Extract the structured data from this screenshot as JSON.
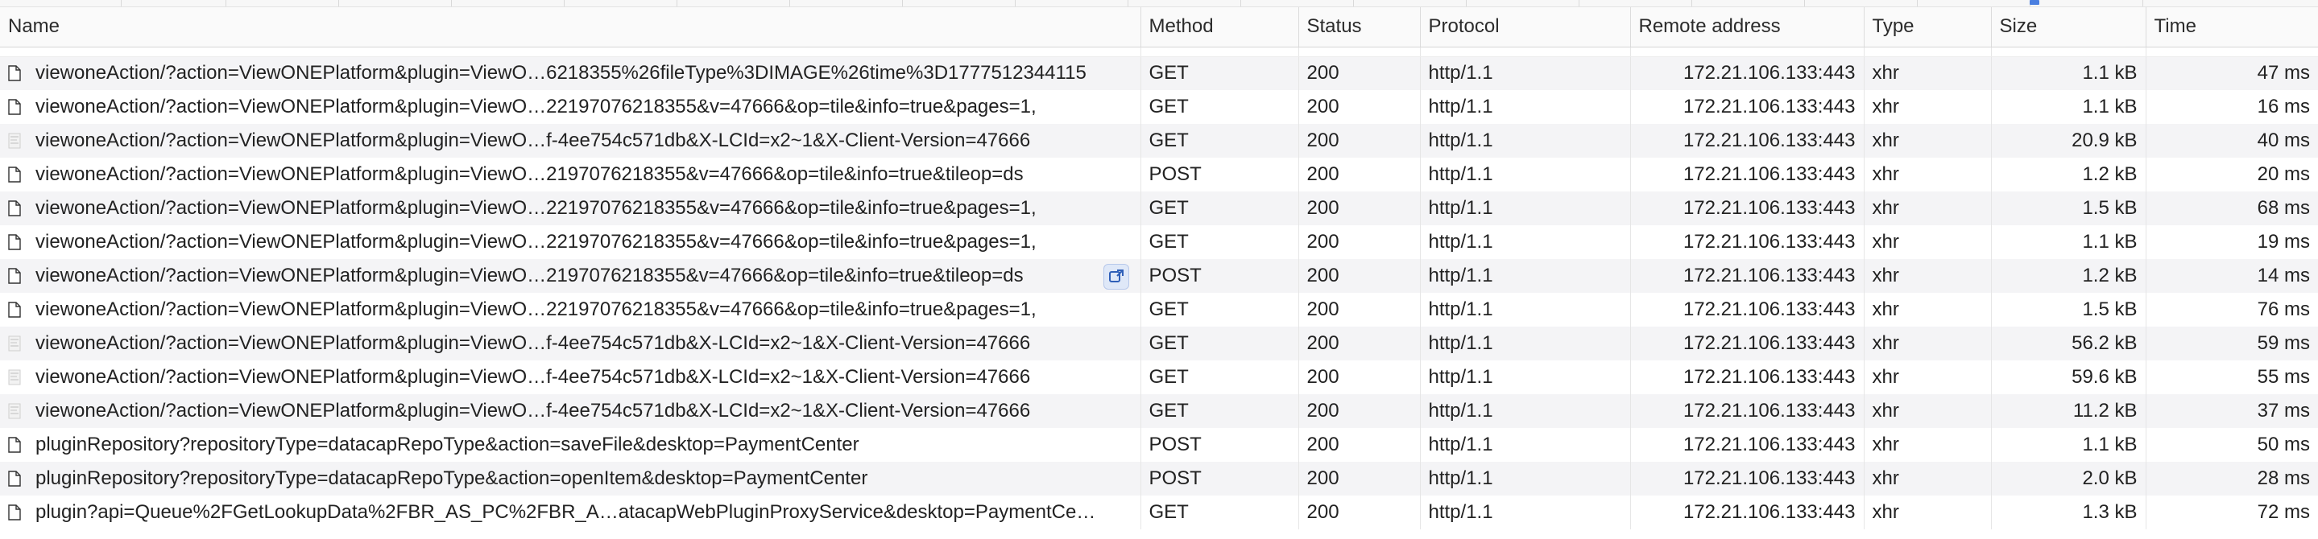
{
  "columns": {
    "name": "Name",
    "method": "Method",
    "status": "Status",
    "protocol": "Protocol",
    "remote": "Remote address",
    "type": "Type",
    "size": "Size",
    "time": "Time"
  },
  "rows": [
    {
      "name": "viewoneAction/?action=ViewONEPlatform&plugin=ViewO…6218355%26fileType%3DIMAGE%26time%3D1777512344115",
      "method": "GET",
      "status": "200",
      "protocol": "http/1.1",
      "remote": "172.21.106.133:443",
      "type": "xhr",
      "size": "1.1 kB",
      "time": "47 ms",
      "icon": "document-icon"
    },
    {
      "name": "viewoneAction/?action=ViewONEPlatform&plugin=ViewO…22197076218355&v=47666&op=tile&info=true&pages=1,",
      "method": "GET",
      "status": "200",
      "protocol": "http/1.1",
      "remote": "172.21.106.133:443",
      "type": "xhr",
      "size": "1.1 kB",
      "time": "16 ms",
      "icon": "document-icon"
    },
    {
      "name": "viewoneAction/?action=ViewONEPlatform&plugin=ViewO…f-4ee754c571db&X-LCId=x2~1&X-Client-Version=47666",
      "method": "GET",
      "status": "200",
      "protocol": "http/1.1",
      "remote": "172.21.106.133:443",
      "type": "xhr",
      "size": "20.9 kB",
      "time": "40 ms",
      "icon": "image-thumb-icon"
    },
    {
      "name": "viewoneAction/?action=ViewONEPlatform&plugin=ViewO…2197076218355&v=47666&op=tile&info=true&tileop=ds",
      "method": "POST",
      "status": "200",
      "protocol": "http/1.1",
      "remote": "172.21.106.133:443",
      "type": "xhr",
      "size": "1.2 kB",
      "time": "20 ms",
      "icon": "document-icon"
    },
    {
      "name": "viewoneAction/?action=ViewONEPlatform&plugin=ViewO…22197076218355&v=47666&op=tile&info=true&pages=1,",
      "method": "GET",
      "status": "200",
      "protocol": "http/1.1",
      "remote": "172.21.106.133:443",
      "type": "xhr",
      "size": "1.5 kB",
      "time": "68 ms",
      "icon": "document-icon"
    },
    {
      "name": "viewoneAction/?action=ViewONEPlatform&plugin=ViewO…22197076218355&v=47666&op=tile&info=true&pages=1,",
      "method": "GET",
      "status": "200",
      "protocol": "http/1.1",
      "remote": "172.21.106.133:443",
      "type": "xhr",
      "size": "1.1 kB",
      "time": "19 ms",
      "icon": "document-icon"
    },
    {
      "name": "viewoneAction/?action=ViewONEPlatform&plugin=ViewO…2197076218355&v=47666&op=tile&info=true&tileop=ds",
      "method": "POST",
      "status": "200",
      "protocol": "http/1.1",
      "remote": "172.21.106.133:443",
      "type": "xhr",
      "size": "1.2 kB",
      "time": "14 ms",
      "icon": "document-icon",
      "badge": "resend-icon"
    },
    {
      "name": "viewoneAction/?action=ViewONEPlatform&plugin=ViewO…22197076218355&v=47666&op=tile&info=true&pages=1,",
      "method": "GET",
      "status": "200",
      "protocol": "http/1.1",
      "remote": "172.21.106.133:443",
      "type": "xhr",
      "size": "1.5 kB",
      "time": "76 ms",
      "icon": "document-icon"
    },
    {
      "name": "viewoneAction/?action=ViewONEPlatform&plugin=ViewO…f-4ee754c571db&X-LCId=x2~1&X-Client-Version=47666",
      "method": "GET",
      "status": "200",
      "protocol": "http/1.1",
      "remote": "172.21.106.133:443",
      "type": "xhr",
      "size": "56.2 kB",
      "time": "59 ms",
      "icon": "image-thumb-icon"
    },
    {
      "name": "viewoneAction/?action=ViewONEPlatform&plugin=ViewO…f-4ee754c571db&X-LCId=x2~1&X-Client-Version=47666",
      "method": "GET",
      "status": "200",
      "protocol": "http/1.1",
      "remote": "172.21.106.133:443",
      "type": "xhr",
      "size": "59.6 kB",
      "time": "55 ms",
      "icon": "image-thumb-icon"
    },
    {
      "name": "viewoneAction/?action=ViewONEPlatform&plugin=ViewO…f-4ee754c571db&X-LCId=x2~1&X-Client-Version=47666",
      "method": "GET",
      "status": "200",
      "protocol": "http/1.1",
      "remote": "172.21.106.133:443",
      "type": "xhr",
      "size": "11.2 kB",
      "time": "37 ms",
      "icon": "image-thumb-icon"
    },
    {
      "name": "pluginRepository?repositoryType=datacapRepoType&action=saveFile&desktop=PaymentCenter",
      "method": "POST",
      "status": "200",
      "protocol": "http/1.1",
      "remote": "172.21.106.133:443",
      "type": "xhr",
      "size": "1.1 kB",
      "time": "50 ms",
      "icon": "document-icon"
    },
    {
      "name": "pluginRepository?repositoryType=datacapRepoType&action=openItem&desktop=PaymentCenter",
      "method": "POST",
      "status": "200",
      "protocol": "http/1.1",
      "remote": "172.21.106.133:443",
      "type": "xhr",
      "size": "2.0 kB",
      "time": "28 ms",
      "icon": "document-icon"
    },
    {
      "name": "plugin?api=Queue%2FGetLookupData%2FBR_AS_PC%2FBR_A…atacapWebPluginProxyService&desktop=PaymentCe…",
      "method": "GET",
      "status": "200",
      "protocol": "http/1.1",
      "remote": "172.21.106.133:443",
      "type": "xhr",
      "size": "1.3 kB",
      "time": "72 ms",
      "icon": "document-icon"
    }
  ]
}
